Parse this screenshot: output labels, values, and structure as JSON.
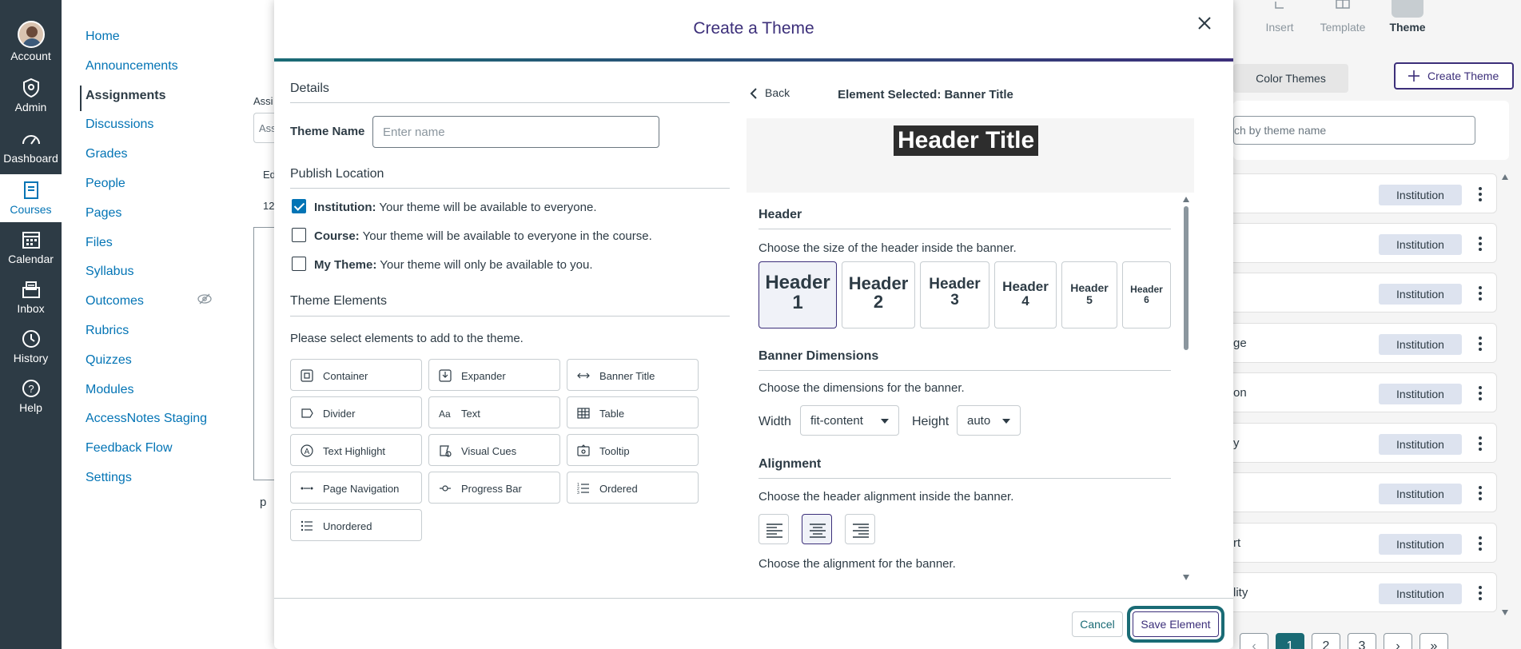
{
  "global_nav": {
    "account": "Account",
    "admin": "Admin",
    "dashboard": "Dashboard",
    "courses": "Courses",
    "calendar": "Calendar",
    "inbox": "Inbox",
    "history": "History",
    "help": "Help"
  },
  "course_nav": {
    "items": [
      "Home",
      "Announcements",
      "Assignments",
      "Discussions",
      "Grades",
      "People",
      "Pages",
      "Files",
      "Syllabus",
      "Outcomes",
      "Rubrics",
      "Quizzes",
      "Modules",
      "AccessNotes Staging",
      "Feedback Flow",
      "Settings"
    ],
    "active": "Assignments"
  },
  "background": {
    "frag1": "Assi",
    "frag2": "Ass",
    "frag3": "Ed",
    "frag4": "12",
    "frag5": "p"
  },
  "right_panel": {
    "tabs": {
      "insert": "Insert",
      "template": "Template",
      "theme": "Theme"
    },
    "color_themes": "Color Themes",
    "create_theme": "Create Theme",
    "search_placeholder": "ch by theme name",
    "rows": [
      {
        "name": "",
        "badge": "Institution"
      },
      {
        "name": "",
        "badge": "Institution"
      },
      {
        "name": "",
        "badge": "Institution"
      },
      {
        "name": "ge",
        "badge": "Institution"
      },
      {
        "name": "on",
        "badge": "Institution"
      },
      {
        "name": "y",
        "badge": "Institution"
      },
      {
        "name": "",
        "badge": "Institution"
      },
      {
        "name": "rt",
        "badge": "Institution"
      },
      {
        "name": "lity",
        "badge": "Institution"
      }
    ],
    "pagination": {
      "prev": "‹",
      "p1": "1",
      "p2": "2",
      "p3": "3",
      "next": "›",
      "last": "»"
    }
  },
  "modal": {
    "title": "Create a Theme",
    "details": "Details",
    "theme_name_label": "Theme Name",
    "theme_name_placeholder": "Enter name",
    "publish_location": "Publish Location",
    "publish": [
      {
        "label": "Institution:",
        "desc": "Your theme will be available to everyone.",
        "checked": true
      },
      {
        "label": "Course:",
        "desc": "Your theme will be available to everyone in the course.",
        "checked": false
      },
      {
        "label": "My Theme:",
        "desc": "Your theme will only be available to you.",
        "checked": false
      }
    ],
    "theme_elements": "Theme Elements",
    "elements_instruction": "Please select elements to add to the theme.",
    "elements": [
      "Container",
      "Expander",
      "Banner Title",
      "Divider",
      "Text",
      "Table",
      "Text Highlight",
      "Visual Cues",
      "Tooltip",
      "Page Navigation",
      "Progress Bar",
      "Ordered",
      "Unordered"
    ],
    "back": "Back",
    "element_selected": "Element Selected: Banner Title",
    "preview_title": "Header Title",
    "header_section": "Header",
    "header_instruction": "Choose the size of the header inside the banner.",
    "header_buttons": [
      {
        "word": "Header",
        "num": "1"
      },
      {
        "word": "Header",
        "num": "2"
      },
      {
        "word": "Header",
        "num": "3"
      },
      {
        "word": "Header",
        "num": "4"
      },
      {
        "word": "Header",
        "num": "5"
      },
      {
        "word": "Header",
        "num": "6"
      }
    ],
    "selected_header": 1,
    "banner_dimensions": "Banner Dimensions",
    "dimensions_instruction": "Choose the dimensions for the banner.",
    "width_label": "Width",
    "width_value": "fit-content",
    "height_label": "Height",
    "height_value": "auto",
    "alignment": "Alignment",
    "alignment_instruction": "Choose the header alignment inside the banner.",
    "selected_alignment": "center",
    "banner_alignment_instruction": "Choose the alignment for the banner.",
    "cancel": "Cancel",
    "save": "Save Element"
  }
}
